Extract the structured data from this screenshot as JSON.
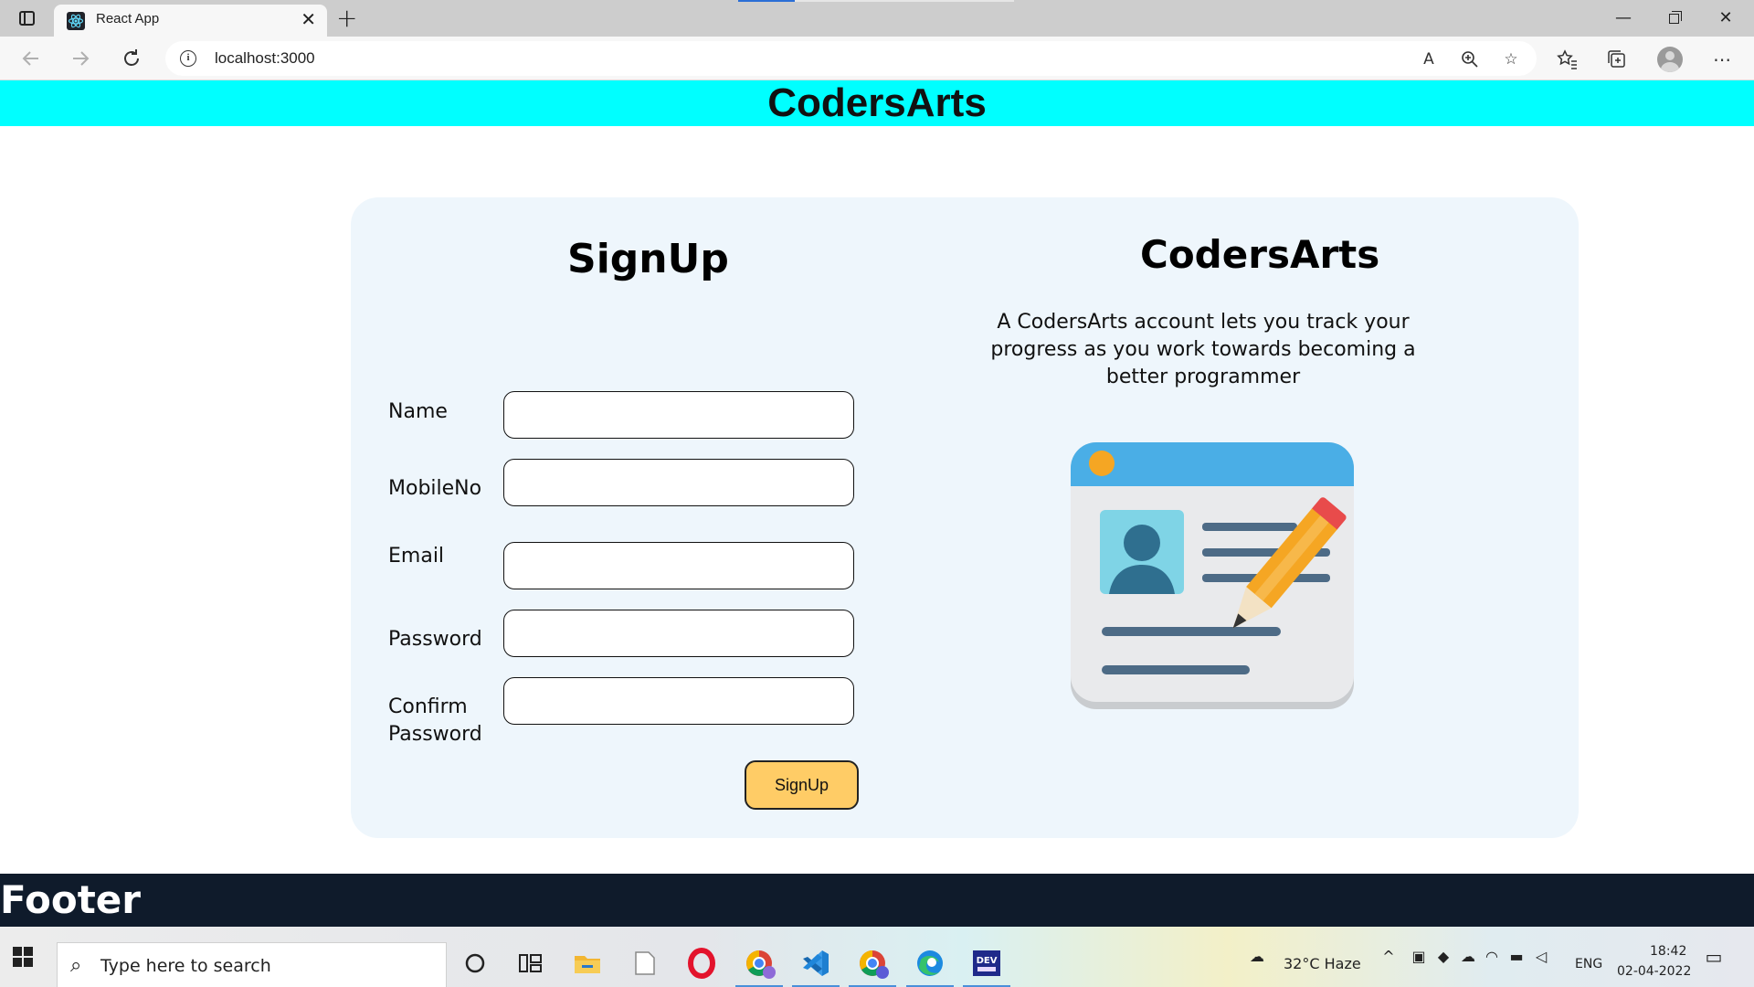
{
  "browser": {
    "tab_title": "React App",
    "tab_close": "✕",
    "new_tab": "+",
    "url": "localhost:3000",
    "window_controls": {
      "minimize": "—",
      "restore": "❐",
      "close": "✕"
    },
    "icons": [
      "tab-actions-icon",
      "back-icon",
      "forward-icon",
      "refresh-icon",
      "info-icon",
      "read-aloud-icon",
      "zoom-icon",
      "add-favorite-icon",
      "favorites-icon",
      "collections-icon",
      "profile-icon",
      "more-icon"
    ]
  },
  "header": {
    "title": "CodersArts"
  },
  "signup": {
    "title": "SignUp",
    "fields": [
      {
        "label": "Name",
        "value": ""
      },
      {
        "label": "MobileNo",
        "value": ""
      },
      {
        "label": "Email",
        "value": ""
      },
      {
        "label": "Password",
        "value": ""
      },
      {
        "label_line1": "Confirm",
        "label_line2": "Password",
        "value": ""
      }
    ],
    "button_label": "SignUp"
  },
  "brand": {
    "title": "CodersArts",
    "description": "A CodersArts account lets you track your progress as you work towards becoming a better programmer"
  },
  "footer": {
    "text": "Footer"
  },
  "taskbar": {
    "search_placeholder": "Type here to search",
    "weather": "32°C  Haze",
    "language": "ENG",
    "time": "18:42",
    "date": "02-04-2022",
    "apps": [
      "cortana-icon",
      "task-view-icon",
      "file-explorer-icon",
      "notepad-icon",
      "opera-icon",
      "chrome-profile-icon",
      "vscode-icon",
      "chrome-icon",
      "edge-icon",
      "dev-icon"
    ]
  },
  "colors": {
    "header_bg": "#00ffff",
    "card_bg": "#eef6fc",
    "button_bg": "#ffcc66",
    "footer_bg": "#0f1b2b"
  }
}
